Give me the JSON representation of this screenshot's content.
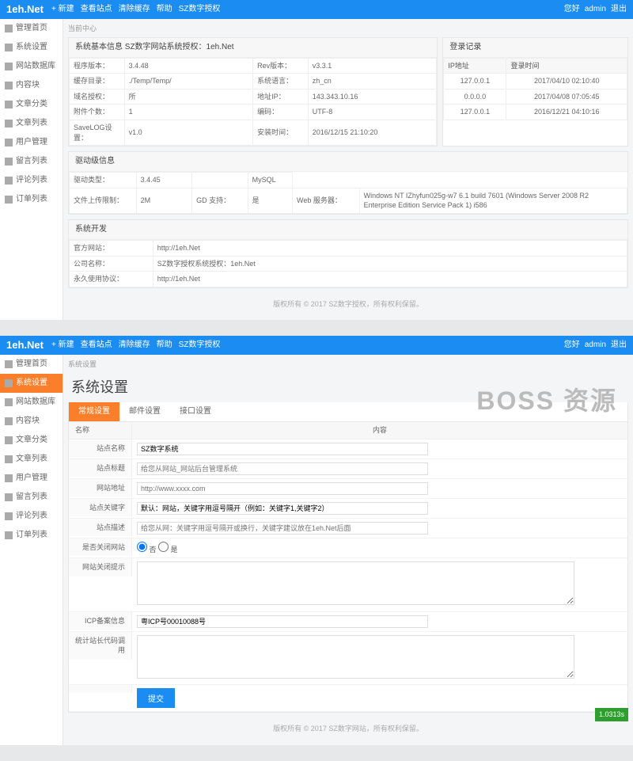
{
  "logo": "1eh.Net",
  "topnav": [
    "+ 新建",
    "查看站点",
    "清除缓存",
    "帮助",
    "SZ数字授权"
  ],
  "toplinks": [
    "您好",
    "admin",
    "退出"
  ],
  "sidebar1": {
    "items": [
      {
        "label": "管理首页"
      },
      {
        "label": "系统设置"
      },
      {
        "label": "网站数据库"
      },
      {
        "label": "内容块"
      },
      {
        "label": "文章分类"
      },
      {
        "label": "文章列表"
      },
      {
        "label": "用户管理"
      },
      {
        "label": "留言列表"
      },
      {
        "label": "评论列表"
      },
      {
        "label": "订单列表"
      }
    ]
  },
  "sidebar2": {
    "items": [
      {
        "label": "管理首页"
      },
      {
        "label": "系统设置",
        "active": true
      },
      {
        "label": "网站数据库"
      },
      {
        "label": "内容块"
      },
      {
        "label": "文章分类"
      },
      {
        "label": "文章列表"
      },
      {
        "label": "用户管理"
      },
      {
        "label": "留言列表"
      },
      {
        "label": "评论列表"
      },
      {
        "label": "订单列表"
      }
    ]
  },
  "dash": {
    "crumb": "当前中心",
    "panel1_title": "系统基本信息 SZ数字网站系统授权：1eh.Net",
    "panel2_title": "登录记录",
    "info_rows": [
      {
        "k1": "程序版本：",
        "v1": "3.4.48",
        "k2": "Rev版本：",
        "v2": "v3.3.1"
      },
      {
        "k1": "缓存目录：",
        "v1": "./Temp/Temp/",
        "k2": "系统语言：",
        "v2": "zh_cn"
      },
      {
        "k1": "域名授权：",
        "v1": "所",
        "k2": "地址IP：",
        "v2": "143.343.10.16"
      },
      {
        "k1": "附件个数：",
        "v1": "1",
        "k2": "编码：",
        "v2": "UTF-8"
      },
      {
        "k1": "SaveLOG设置：",
        "v1": "v1.0",
        "k2": "安装时间：",
        "v2": "2016/12/15 21:10:20"
      }
    ],
    "login_th": [
      "IP地址",
      "登录时间"
    ],
    "login_rows": [
      {
        "ip": "127.0.0.1",
        "t": "2017/04/10 02:10:40"
      },
      {
        "ip": "0.0.0.0",
        "t": "2017/04/08 07:05:45"
      },
      {
        "ip": "127.0.0.1",
        "t": "2016/12/21 04:10:16"
      }
    ],
    "drv_title": "驱动级信息",
    "drv_rows": [
      {
        "k": "驱动类型：",
        "v": "3.4.45",
        "k2": "",
        "v2": "MySQL"
      },
      {
        "k": "文件上传限制：",
        "v": "2M",
        "k2": "GD 支持：",
        "v2": "是",
        "k3": "Web 服务器：",
        "v3": "Windows NT IZhyfun025g-w7 6.1 build 7601 (Windows Server 2008 R2 Enterprise Edition Service Pack 1) i586"
      }
    ],
    "dev_title": "系统开发",
    "dev_rows": [
      {
        "k": "官方网站：",
        "v": "http://1eh.Net"
      },
      {
        "k": "公司名称：",
        "v": "SZ数字授权系统授权：1eh.Net"
      },
      {
        "k": "永久使用协议：",
        "v": "http://1eh.Net"
      }
    ],
    "footer": "版权所有 © 2017 SZ数字授权，所有权利保留。"
  },
  "settings": {
    "crumb": "系统设置",
    "title": "系统设置",
    "tabs": [
      "常规设置",
      "邮件设置",
      "接口设置"
    ],
    "th": [
      "名称",
      "内容"
    ],
    "rows": [
      {
        "label": "站点名称",
        "value": "SZ数字系统",
        "type": "text"
      },
      {
        "label": "站点标题",
        "value": "",
        "ph": "给您从网站_网站后台管理系统",
        "type": "text"
      },
      {
        "label": "网站地址",
        "value": "",
        "ph": "http://www.xxxx.com",
        "type": "text"
      },
      {
        "label": "站点关键字",
        "value": "默认：网站，关键字用逗号隔开（例如：关键字1,关键字2）",
        "type": "text"
      },
      {
        "label": "站点描述",
        "value": "",
        "ph": "给您从网：关键字用逗号隔开或换行，关键字建议放在1eh.Net后面",
        "type": "text"
      },
      {
        "label": "是否关闭网站",
        "value": "",
        "type": "radio",
        "opts": [
          "否",
          "是"
        ]
      },
      {
        "label": "网站关闭提示",
        "value": "",
        "type": "textarea"
      },
      {
        "label": "ICP备案信息",
        "value": "粤ICP号00010088号",
        "type": "text"
      },
      {
        "label": "统计站长代码调用",
        "value": "",
        "type": "textarea"
      }
    ],
    "submit": "提交",
    "footer": "版权所有 © 2017 SZ数字网站，所有权利保留。",
    "badge": "1.0313s"
  },
  "watermark": "BOSS 资源"
}
